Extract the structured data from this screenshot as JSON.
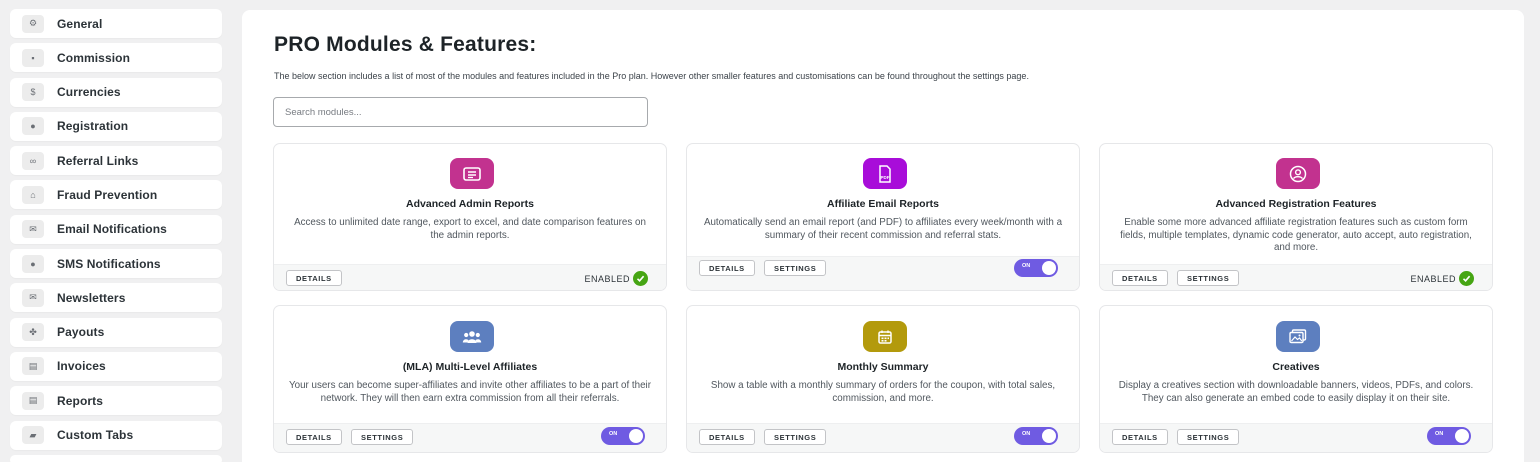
{
  "sidebar": {
    "items": [
      {
        "label": "General",
        "icon": "gear-icon",
        "glyph": "⚙"
      },
      {
        "label": "Commission",
        "icon": "money-icon",
        "glyph": "▪"
      },
      {
        "label": "Currencies",
        "icon": "dollar-icon",
        "glyph": "$"
      },
      {
        "label": "Registration",
        "icon": "user-circle-icon",
        "glyph": "●"
      },
      {
        "label": "Referral Links",
        "icon": "link-icon",
        "glyph": "∞"
      },
      {
        "label": "Fraud Prevention",
        "icon": "bank-icon",
        "glyph": "⌂"
      },
      {
        "label": "Email Notifications",
        "icon": "envelope-icon",
        "glyph": "✉"
      },
      {
        "label": "SMS Notifications",
        "icon": "chat-icon",
        "glyph": "●"
      },
      {
        "label": "Newsletters",
        "icon": "envelope-icon",
        "glyph": "✉"
      },
      {
        "label": "Payouts",
        "icon": "handshake-icon",
        "glyph": "✤"
      },
      {
        "label": "Invoices",
        "icon": "file-icon",
        "glyph": "▤"
      },
      {
        "label": "Reports",
        "icon": "file-icon",
        "glyph": "▤"
      },
      {
        "label": "Custom Tabs",
        "icon": "folder-plus-icon",
        "glyph": "▰"
      }
    ]
  },
  "main": {
    "title": "PRO Modules & Features:",
    "intro": "The below section includes a list of most of the modules and features included in the Pro plan. However other smaller features and customisations can be found throughout the settings page.",
    "search_placeholder": "Search modules..."
  },
  "labels": {
    "details": "DETAILS",
    "settings": "SETTINGS",
    "enabled": "ENABLED",
    "toggle_on": "ON"
  },
  "modules": [
    {
      "title": "Advanced Admin Reports",
      "description": "Access to unlimited date range, export to excel, and date comparison features on the admin reports.",
      "icon": "report-icon",
      "color": "#c2328f",
      "status": "enabled",
      "has_settings": false
    },
    {
      "title": "Affiliate Email Reports",
      "description": "Automatically send an email report (and PDF) to affiliates every week/month with a summary of their recent commission and referral stats.",
      "icon": "pdf-icon",
      "color": "#a80dd9",
      "status": "toggle",
      "has_settings": true
    },
    {
      "title": "Advanced Registration Features",
      "description": "Enable some more advanced affiliate registration features such as custom form fields, multiple templates, dynamic code generator, auto accept, auto registration, and more.",
      "icon": "user-circle-icon",
      "color": "#c2328f",
      "status": "enabled",
      "has_settings": true
    },
    {
      "title": "(MLA) Multi-Level Affiliates",
      "description": "Your users can become super-affiliates and invite other affiliates to be a part of their network. They will then earn extra commission from all their referrals.",
      "icon": "users-icon",
      "color": "#5d7fbf",
      "status": "toggle",
      "has_settings": true
    },
    {
      "title": "Monthly Summary",
      "description": "Show a table with a monthly summary of orders for the coupon, with total sales, commission, and more.",
      "icon": "calendar-icon",
      "color": "#b39a0c",
      "status": "toggle",
      "has_settings": true
    },
    {
      "title": "Creatives",
      "description": "Display a creatives section with downloadable banners, videos, PDFs, and colors. They can also generate an embed code to easily display it on their site.",
      "icon": "image-icon",
      "color": "#5d7fbf",
      "status": "toggle",
      "has_settings": true
    }
  ],
  "colors": {
    "toggle_on": "#6f5be2",
    "enabled_check": "#46a513"
  }
}
